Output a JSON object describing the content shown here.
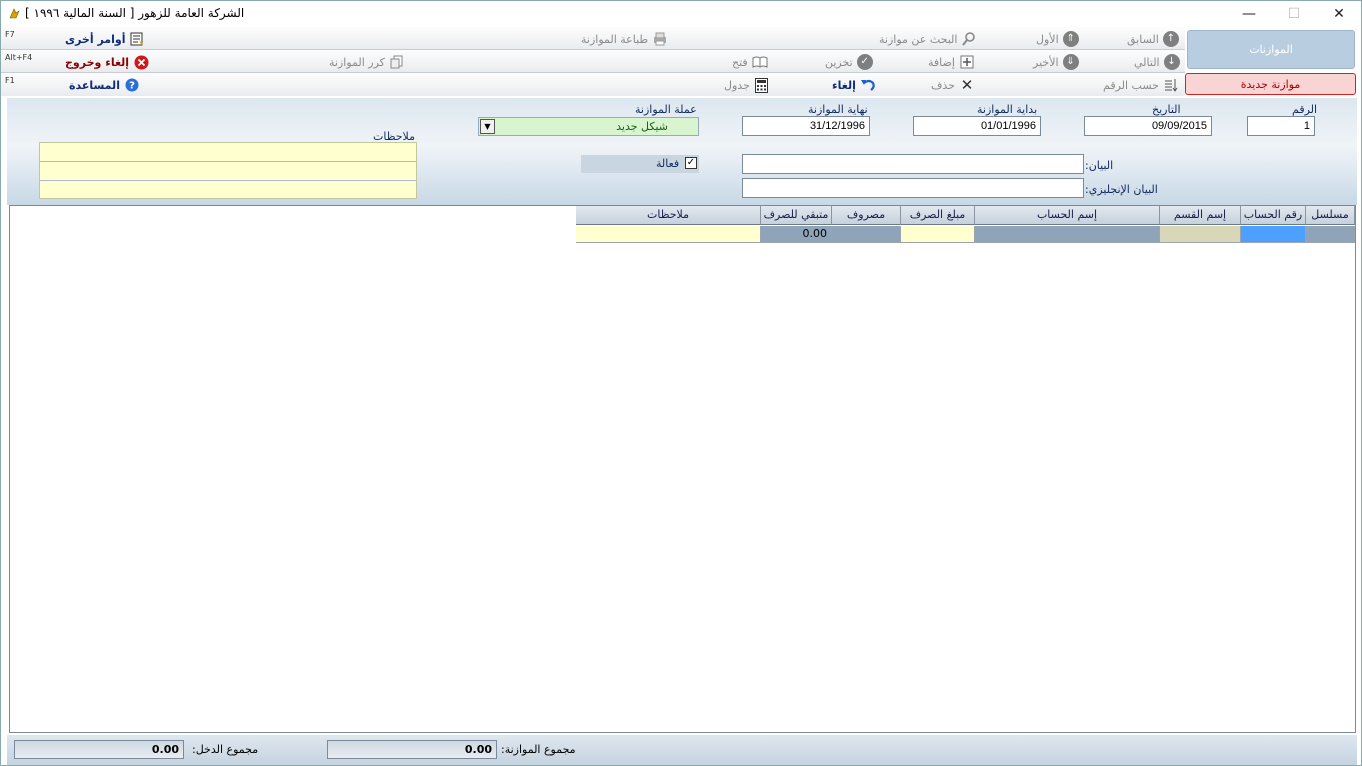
{
  "window": {
    "title": "الشركة العامة للزهور [ السنة المالية ١٩٩٦ ]",
    "minimize": "—",
    "maximize": "☐",
    "close": "✕"
  },
  "toolbar": {
    "row1": {
      "previous": "السابق",
      "first": "الأول",
      "search": "البحث عن موازنة",
      "print": "طباعة الموازنة",
      "other_commands": "أوامر أخرى",
      "shortcut": "F7"
    },
    "row2": {
      "next": "التالي",
      "last": "الأخير",
      "add": "إضافة",
      "save": "تخزين",
      "open": "فتح",
      "repeat": "كرر الموازنة",
      "cancel_exit": "إلغاء وخروج",
      "shortcut": "Alt+F4"
    },
    "row3": {
      "by_number": "حسب الرقم",
      "delete": "حذف",
      "cancel": "إلغاء",
      "table": "جدول",
      "help": "المساعدة",
      "shortcut": "F1"
    }
  },
  "side": {
    "budgets_button": "الموازنات",
    "new_budget_button": "موازنة جديدة"
  },
  "form": {
    "number_label": "الرقم",
    "number_value": "1",
    "date_label": "التاريخ",
    "date_value": "09/09/2015",
    "start_label": "بداية الموازنة",
    "start_value": "01/01/1996",
    "end_label": "نهاية الموازنة",
    "end_value": "31/12/1996",
    "currency_label": "عملة الموازنة",
    "currency_value": "شيكل جديد",
    "notes_label": "ملاحظات",
    "active_label": "فعالة",
    "description_label": "البيان:",
    "description_value": "",
    "english_label": "البيان الإنجليزي:",
    "english_value": ""
  },
  "grid": {
    "headers": [
      "مسلسل",
      "رقم الحساب",
      "إسم القسم",
      "إسم الحساب",
      "مبلغ الصرف",
      "مصروف",
      "متبقي للصرف",
      "ملاحظات"
    ],
    "row": {
      "remaining": "0.00"
    }
  },
  "status": {
    "income_total_label": "مجموع الدخل:",
    "income_total_value": "0.00",
    "budget_total_label": "مجموع الموازنة:",
    "budget_total_value": "0.00"
  },
  "colors": {
    "new_budget_bg": "#f8d4d4",
    "new_budget_border": "#d62020",
    "budgets_btn_bg": "#b8cee0",
    "currency_bg": "#d8f5d0",
    "notes_bg": "#ffffd0",
    "selected_cell": "#4da0ff"
  }
}
